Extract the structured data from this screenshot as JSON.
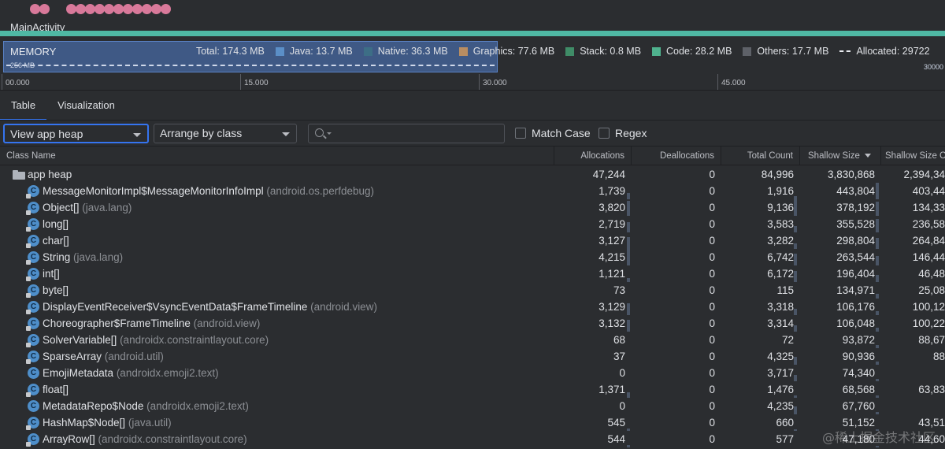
{
  "timeline": {
    "activity": "MainActivity"
  },
  "memory": {
    "title": "MEMORY",
    "scale_left": "256 MB",
    "scale_right": "30000",
    "legend": [
      {
        "label": "Total: 174.3 MB",
        "color": null
      },
      {
        "label": "Java: 13.7 MB",
        "color": "#5b8fc7"
      },
      {
        "label": "Native: 36.3 MB",
        "color": "#3d6e86"
      },
      {
        "label": "Graphics: 77.6 MB",
        "color": "#b88d62"
      },
      {
        "label": "Stack: 0.8 MB",
        "color": "#3f8c67"
      },
      {
        "label": "Code: 28.2 MB",
        "color": "#4fb28e"
      },
      {
        "label": "Others: 17.7 MB",
        "color": "#5e6168"
      },
      {
        "label": "Allocated: 29722",
        "color": "dashed"
      }
    ]
  },
  "ruler": {
    "ticks": [
      "00.000",
      "15.000",
      "30.000",
      "45.000"
    ]
  },
  "tabs": [
    {
      "label": "Table",
      "active": true
    },
    {
      "label": "Visualization",
      "active": false
    }
  ],
  "toolbar": {
    "heap_select": "View app heap",
    "arrange_select": "Arrange by class",
    "search_placeholder": "",
    "match_case": "Match Case",
    "regex": "Regex"
  },
  "table": {
    "headers": {
      "class_name": "Class Name",
      "allocations": "Allocations",
      "deallocations": "Deallocations",
      "total_count": "Total Count",
      "shallow_size": "Shallow Size",
      "shallow_size_change": "Shallow Size C"
    },
    "rows": [
      {
        "name": "app heap",
        "pkg": "",
        "icon": "folder",
        "alloc": "47,244",
        "dealloc": "0",
        "total": "84,996",
        "shallow": "3,830,868",
        "change": "2,394,34"
      },
      {
        "name": "MessageMonitorImpl$MessageMonitorInfoImpl",
        "pkg": "(android.os.perfdebug)",
        "icon": "class-field",
        "alloc": "1,739",
        "dealloc": "0",
        "total": "1,916",
        "shallow": "443,804",
        "change": "403,44"
      },
      {
        "name": "Object[]",
        "pkg": "(java.lang)",
        "icon": "class-field",
        "alloc": "3,820",
        "dealloc": "0",
        "total": "9,136",
        "shallow": "378,192",
        "change": "134,33"
      },
      {
        "name": "long[]",
        "pkg": "",
        "icon": "class-field",
        "alloc": "2,719",
        "dealloc": "0",
        "total": "3,583",
        "shallow": "355,528",
        "change": "236,58"
      },
      {
        "name": "char[]",
        "pkg": "",
        "icon": "class-field",
        "alloc": "3,127",
        "dealloc": "0",
        "total": "3,282",
        "shallow": "298,804",
        "change": "264,84"
      },
      {
        "name": "String",
        "pkg": "(java.lang)",
        "icon": "class-field",
        "alloc": "4,215",
        "dealloc": "0",
        "total": "6,742",
        "shallow": "263,544",
        "change": "146,44"
      },
      {
        "name": "int[]",
        "pkg": "",
        "icon": "class-field",
        "alloc": "1,121",
        "dealloc": "0",
        "total": "6,172",
        "shallow": "196,404",
        "change": "46,48"
      },
      {
        "name": "byte[]",
        "pkg": "",
        "icon": "class-field",
        "alloc": "73",
        "dealloc": "0",
        "total": "115",
        "shallow": "134,971",
        "change": "25,08"
      },
      {
        "name": "DisplayEventReceiver$VsyncEventData$FrameTimeline",
        "pkg": "(android.view)",
        "icon": "class-field",
        "alloc": "3,129",
        "dealloc": "0",
        "total": "3,318",
        "shallow": "106,176",
        "change": "100,12"
      },
      {
        "name": "Choreographer$FrameTimeline",
        "pkg": "(android.view)",
        "icon": "class-field",
        "alloc": "3,132",
        "dealloc": "0",
        "total": "3,314",
        "shallow": "106,048",
        "change": "100,22"
      },
      {
        "name": "SolverVariable[]",
        "pkg": "(androidx.constraintlayout.core)",
        "icon": "class-field",
        "alloc": "68",
        "dealloc": "0",
        "total": "72",
        "shallow": "93,872",
        "change": "88,67"
      },
      {
        "name": "SparseArray",
        "pkg": "(android.util)",
        "icon": "class-field",
        "alloc": "37",
        "dealloc": "0",
        "total": "4,325",
        "shallow": "90,936",
        "change": "88"
      },
      {
        "name": "EmojiMetadata",
        "pkg": "(androidx.emoji2.text)",
        "icon": "class",
        "alloc": "0",
        "dealloc": "0",
        "total": "3,717",
        "shallow": "74,340",
        "change": ""
      },
      {
        "name": "float[]",
        "pkg": "",
        "icon": "class-field",
        "alloc": "1,371",
        "dealloc": "0",
        "total": "1,476",
        "shallow": "68,568",
        "change": "63,83"
      },
      {
        "name": "MetadataRepo$Node",
        "pkg": "(androidx.emoji2.text)",
        "icon": "class",
        "alloc": "0",
        "dealloc": "0",
        "total": "4,235",
        "shallow": "67,760",
        "change": ""
      },
      {
        "name": "HashMap$Node[]",
        "pkg": "(java.util)",
        "icon": "class-field",
        "alloc": "545",
        "dealloc": "0",
        "total": "660",
        "shallow": "51,152",
        "change": "43,51"
      },
      {
        "name": "ArrayRow[]",
        "pkg": "(androidx.constraintlayout.core)",
        "icon": "class-field",
        "alloc": "544",
        "dealloc": "0",
        "total": "577",
        "shallow": "47,180",
        "change": "44,60"
      }
    ]
  },
  "watermark": "@稀土掘金技术社区"
}
